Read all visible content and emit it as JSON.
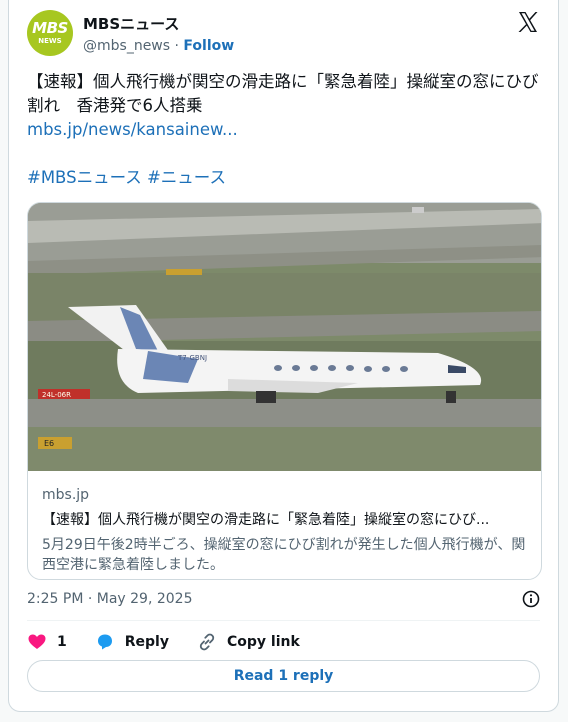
{
  "author": {
    "avatar_line1": "MBS",
    "avatar_line2": "NEWS",
    "name": "MBSニュース",
    "handle": "@mbs_news",
    "separator": "·",
    "follow_label": "Follow"
  },
  "tweet": {
    "text": "【速報】個人飛行機が関空の滑走路に「緊急着陸」操縦室の窓にひび割れ　香港発で6人搭乗",
    "link": "mbs.jp/news/kansainew...",
    "hashtags": "#MBSニュース #ニュース"
  },
  "media": {
    "aircraft_registration": "T7-GBNJ",
    "sign_1": "24L-06R",
    "sign_2": "E6",
    "domain": "mbs.jp",
    "title": "【速報】個人飛行機が関空の滑走路に「緊急着陸」操縦室の窓にひび...",
    "description": "5月29日午後2時半ごろ、操縦室の窓にひび割れが発生した個人飛行機が、関西空港に緊急着陸しました。"
  },
  "meta": {
    "timestamp": "2:25 PM · May 29, 2025"
  },
  "actions": {
    "like_count": "1",
    "reply_label": "Reply",
    "copy_link_label": "Copy link",
    "read_reply_label": "Read 1 reply"
  },
  "colors": {
    "link": "#1d70b8",
    "heart": "#f91880",
    "avatar": "#a7c720",
    "reply_icon": "#1d9bf0"
  }
}
